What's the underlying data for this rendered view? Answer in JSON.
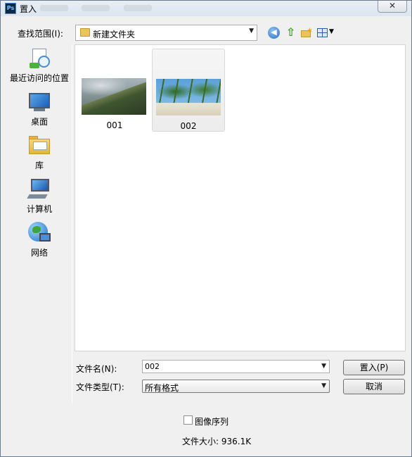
{
  "window": {
    "app_icon": "photoshop-icon",
    "title": "置入",
    "close_glyph": "✕"
  },
  "look_in": {
    "label": "查找范围(I):",
    "value": "新建文件夹"
  },
  "toolbar": {
    "back_icon": "back-arrow-icon",
    "up_icon": "up-folder-icon",
    "new_folder_icon": "new-folder-icon",
    "views_icon": "views-menu-icon"
  },
  "places": [
    {
      "label": "最近访问的位置",
      "icon": "recent-places-icon"
    },
    {
      "label": "桌面",
      "icon": "desktop-icon"
    },
    {
      "label": "库",
      "icon": "libraries-icon"
    },
    {
      "label": "计算机",
      "icon": "computer-icon"
    },
    {
      "label": "网络",
      "icon": "network-icon"
    }
  ],
  "files": [
    {
      "name": "001",
      "selected": false
    },
    {
      "name": "002",
      "selected": true
    }
  ],
  "filename": {
    "label": "文件名(N):",
    "value": "002"
  },
  "filetype": {
    "label": "文件类型(T):",
    "value": "所有格式"
  },
  "buttons": {
    "place": "置入(P)",
    "cancel": "取消"
  },
  "image_sequence": {
    "label": "图像序列",
    "checked": false
  },
  "file_size": "文件大小: 936.1K"
}
